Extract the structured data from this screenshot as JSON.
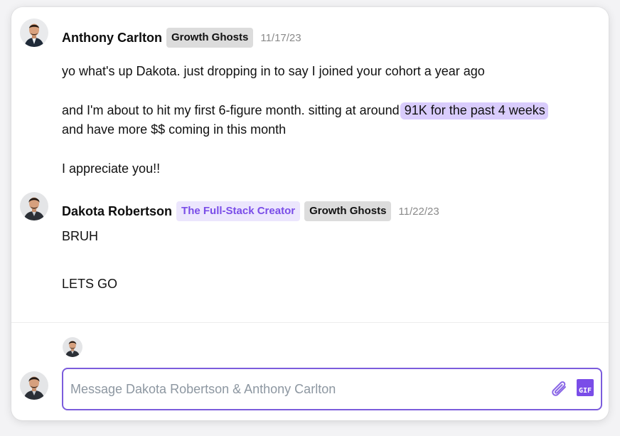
{
  "messages": [
    {
      "author": "Anthony Carlton",
      "badges": [
        "Growth Ghosts"
      ],
      "timestamp": "11/17/23",
      "lines": {
        "l1": "yo what's up Dakota. just dropping in to say I joined your cohort a year ago",
        "l2_pre": "and I'm about to hit my first 6-figure month. sitting at around",
        "l2_highlight": "91K for the past 4 weeks",
        "l3": "and have more $$ coming in this month",
        "l4": "I appreciate you!!"
      }
    },
    {
      "author": "Dakota Robertson",
      "badges": [
        "The Full-Stack Creator",
        "Growth Ghosts"
      ],
      "timestamp": "11/22/23",
      "lines": {
        "l1": "BRUH",
        "l2": "LETS GO"
      }
    }
  ],
  "composer": {
    "placeholder": "Message Dakota Robertson & Anthony Carlton",
    "gif_label": "GIF"
  },
  "icons": {
    "attach": "paperclip-icon",
    "gif": "gif-icon"
  },
  "colors": {
    "accent": "#7a4de8",
    "highlight": "#d9ccfc",
    "badge_gray": "#dcdcdc",
    "badge_purple_bg": "#ece6fd",
    "composer_border": "#7b5cdc"
  }
}
